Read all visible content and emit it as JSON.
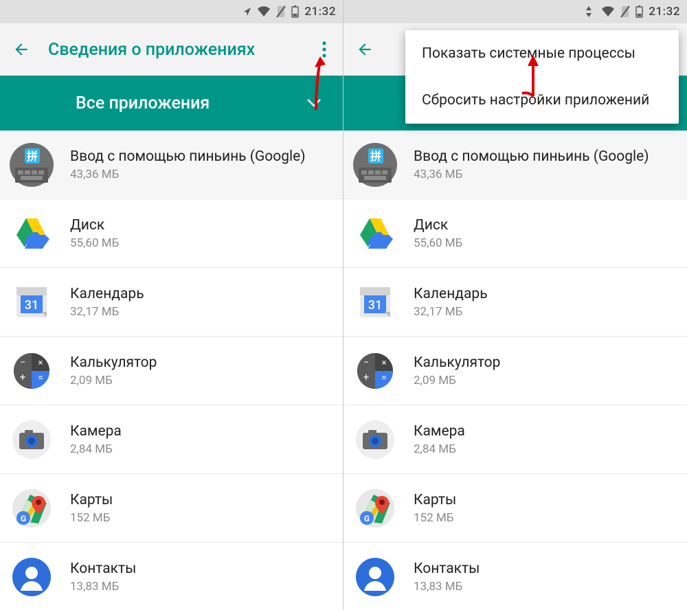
{
  "status": {
    "time": "21:32"
  },
  "appbar": {
    "title": "Сведения о приложениях"
  },
  "section": {
    "label": "Все приложения"
  },
  "popup": {
    "item1": "Показать системные процессы",
    "item2": "Сбросить настройки приложений"
  },
  "apps": [
    {
      "name": "Ввод с помощью пиньинь (Google)",
      "size": "43,36 МБ"
    },
    {
      "name": "Диск",
      "size": "55,60 МБ"
    },
    {
      "name": "Календарь",
      "size": "32,17 МБ"
    },
    {
      "name": "Калькулятор",
      "size": "2,09 МБ"
    },
    {
      "name": "Камера",
      "size": "2,84 МБ"
    },
    {
      "name": "Карты",
      "size": "152 МБ"
    },
    {
      "name": "Контакты",
      "size": "13,83 МБ"
    }
  ]
}
